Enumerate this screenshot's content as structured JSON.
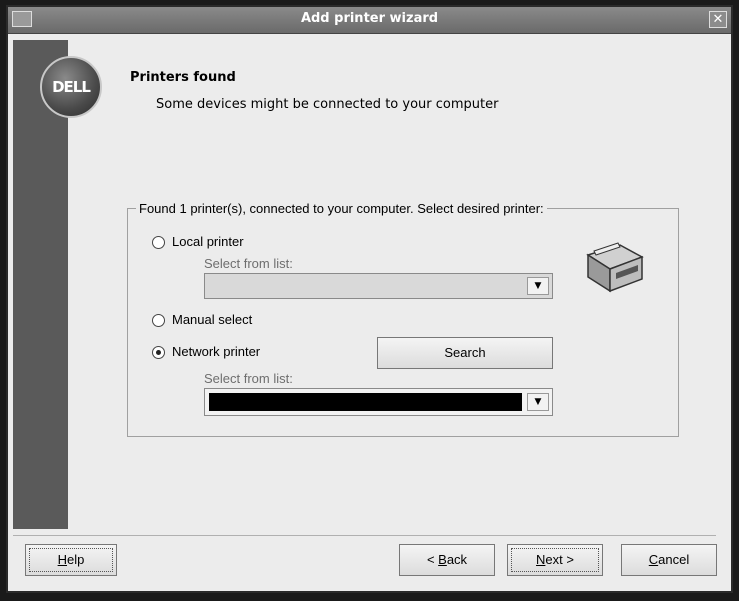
{
  "window": {
    "title": "Add printer wizard",
    "close_glyph": "✕"
  },
  "logo": {
    "text": "DELL"
  },
  "header": {
    "title": "Printers found",
    "subtitle": "Some devices might be connected to your computer"
  },
  "group": {
    "legend": "Found 1 printer(s), connected to your computer. Select desired printer:",
    "local_printer": {
      "label": "Local printer",
      "selected": false,
      "sublabel": "Select from list:",
      "value": ""
    },
    "manual_select": {
      "label": "Manual select",
      "selected": false
    },
    "network_printer": {
      "label": "Network printer",
      "selected": true,
      "sublabel": "Select from list:",
      "value": ""
    },
    "search_button": "Search",
    "icon": "printer-icon"
  },
  "footer": {
    "help_pre": "",
    "help_mn": "H",
    "help_post": "elp",
    "back_pre": "< ",
    "back_mn": "B",
    "back_post": "ack",
    "next_pre": "",
    "next_mn": "N",
    "next_post": "ext >",
    "cancel_pre": "",
    "cancel_mn": "C",
    "cancel_post": "ancel"
  }
}
